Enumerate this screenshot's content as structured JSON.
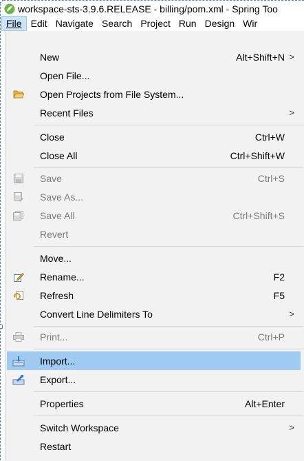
{
  "window": {
    "title": "workspace-sts-3.9.6.RELEASE - billing/pom.xml - Spring Too"
  },
  "menubar": {
    "items": [
      {
        "label": "File",
        "active": true
      },
      {
        "label": "Edit"
      },
      {
        "label": "Navigate"
      },
      {
        "label": "Search"
      },
      {
        "label": "Project"
      },
      {
        "label": "Run"
      },
      {
        "label": "Design"
      },
      {
        "label": "Wir"
      }
    ]
  },
  "menu": {
    "new": {
      "label": "New",
      "accel": "Alt+Shift+N",
      "arrow": ">"
    },
    "open_file": {
      "label": "Open File..."
    },
    "open_projects": {
      "label": "Open Projects from File System..."
    },
    "recent_files": {
      "label": "Recent Files",
      "arrow": ">"
    },
    "close": {
      "label": "Close",
      "accel": "Ctrl+W"
    },
    "close_all": {
      "label": "Close All",
      "accel": "Ctrl+Shift+W"
    },
    "save": {
      "label": "Save",
      "accel": "Ctrl+S"
    },
    "save_as": {
      "label": "Save As..."
    },
    "save_all": {
      "label": "Save All",
      "accel": "Ctrl+Shift+S"
    },
    "revert": {
      "label": "Revert"
    },
    "move": {
      "label": "Move..."
    },
    "rename": {
      "label": "Rename...",
      "accel": "F2"
    },
    "refresh": {
      "label": "Refresh",
      "accel": "F5"
    },
    "convert": {
      "label": "Convert Line Delimiters To",
      "arrow": ">"
    },
    "print": {
      "label": "Print...",
      "accel": "Ctrl+P"
    },
    "import": {
      "label": "Import..."
    },
    "export": {
      "label": "Export..."
    },
    "properties": {
      "label": "Properties",
      "accel": "Alt+Enter"
    },
    "switch_workspace": {
      "label": "Switch Workspace",
      "arrow": ">"
    },
    "restart": {
      "label": "Restart"
    }
  },
  "colors": {
    "highlight": "#9fcaf2",
    "menu_bg": "#f2f2f2",
    "disabled_text": "#7a7a7a",
    "selection_border": "#4a7fd4"
  }
}
